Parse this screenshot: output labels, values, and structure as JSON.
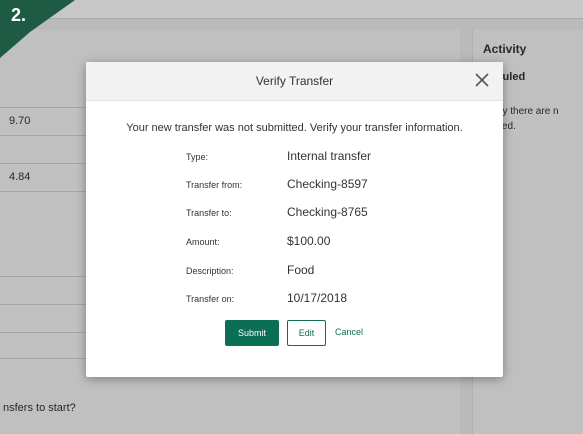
{
  "step_badge": {
    "label": "2.",
    "color": "#1e5b44"
  },
  "background": {
    "amounts": [
      "9.70",
      "4.84"
    ],
    "bottom_prompt": "nsfers to start?",
    "activity": {
      "title": "Activity",
      "scheduled": "neduled",
      "empty_line1": "rently there are n",
      "empty_line2": "eduled."
    }
  },
  "modal": {
    "title": "Verify Transfer",
    "close_icon": "close-icon",
    "intro": "Your new transfer was not submitted. Verify your transfer information.",
    "rows": [
      {
        "label": "Type:",
        "value": "Internal transfer"
      },
      {
        "label": "Transfer from:",
        "value": "Checking-8597"
      },
      {
        "label": "Transfer to:",
        "value": "Checking-8765"
      },
      {
        "label": "Amount:",
        "value": "$100.00"
      },
      {
        "label": "Description:",
        "value": "Food"
      },
      {
        "label": "Transfer on:",
        "value": "10/17/2018"
      }
    ],
    "buttons": {
      "submit": "Submit",
      "edit": "Edit",
      "cancel": "Cancel"
    },
    "accent_color": "#0b6e55"
  }
}
